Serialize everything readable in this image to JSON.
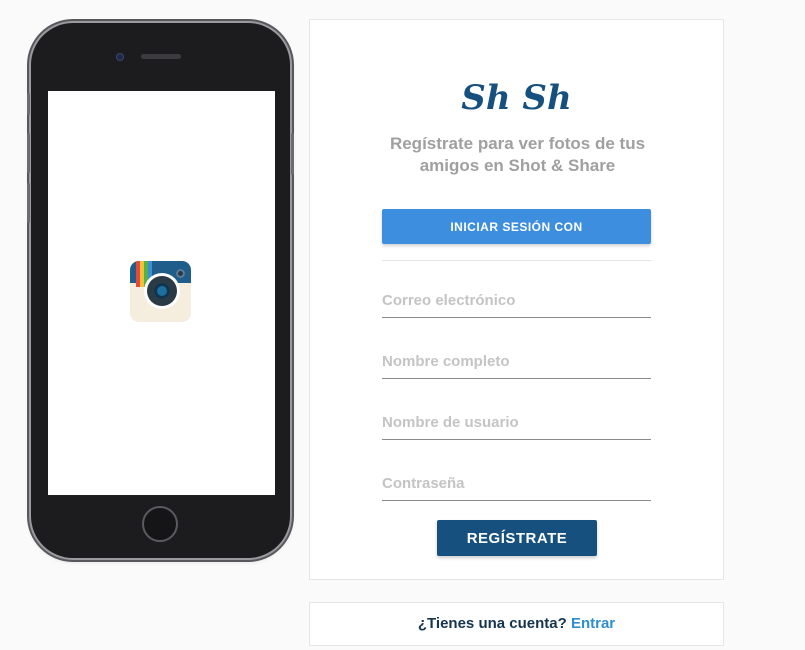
{
  "signup": {
    "logo": "Sh Sh",
    "tagline": "Regístrate para ver fotos de tus amigos en Shot & Share",
    "facebook_button_label": "INICIAR SESIÓN CON",
    "fields": {
      "email_placeholder": "Correo electrónico",
      "fullname_placeholder": "Nombre completo",
      "username_placeholder": "Nombre de usuario",
      "password_placeholder": "Contraseña"
    },
    "submit_label": "REGÍSTRATE"
  },
  "login_prompt": {
    "question": "¿Tienes una cuenta?",
    "link": "Entrar"
  },
  "icons": {
    "app_icon": "camera-app-icon"
  },
  "colors": {
    "brand": "#15507f",
    "facebook_button": "#3e8ee0",
    "link": "#2e8fd0",
    "placeholder": "#c4c4c4"
  }
}
